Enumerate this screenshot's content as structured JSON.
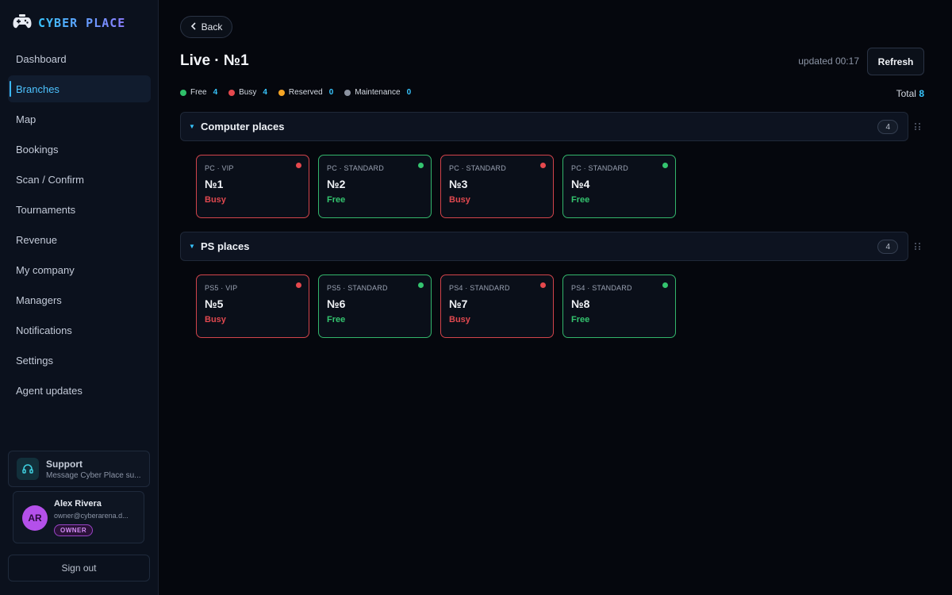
{
  "brand": {
    "name": "CYBER PLACE"
  },
  "sidebar": {
    "items": [
      {
        "label": "Dashboard"
      },
      {
        "label": "Branches"
      },
      {
        "label": "Map"
      },
      {
        "label": "Bookings"
      },
      {
        "label": "Scan / Confirm"
      },
      {
        "label": "Tournaments"
      },
      {
        "label": "Revenue"
      },
      {
        "label": "My company"
      },
      {
        "label": "Managers"
      },
      {
        "label": "Notifications"
      },
      {
        "label": "Settings"
      },
      {
        "label": "Agent updates"
      }
    ],
    "active_index": 1
  },
  "support": {
    "title": "Support",
    "subtitle": "Message Cyber Place su..."
  },
  "user": {
    "initials": "AR",
    "name": "Alex Rivera",
    "email": "owner@cyberarena.d...",
    "role": "OWNER"
  },
  "signout_label": "Sign out",
  "header": {
    "back_label": "Back",
    "title": "Live · №1",
    "updated": "updated 00:17",
    "refresh_label": "Refresh"
  },
  "legend": [
    {
      "label": "Free",
      "count": "4",
      "color": "#2fc06a"
    },
    {
      "label": "Busy",
      "count": "4",
      "color": "#e5484d"
    },
    {
      "label": "Reserved",
      "count": "0",
      "color": "#f5a524"
    },
    {
      "label": "Maintenance",
      "count": "0",
      "color": "#8b92a0"
    }
  ],
  "total": {
    "label": "Total",
    "value": "8"
  },
  "sections": [
    {
      "title": "Computer places",
      "count": "4",
      "places": [
        {
          "type": "PC · VIP",
          "number": "№1",
          "status": "Busy"
        },
        {
          "type": "PC · STANDARD",
          "number": "№2",
          "status": "Free"
        },
        {
          "type": "PC · STANDARD",
          "number": "№3",
          "status": "Busy"
        },
        {
          "type": "PC · STANDARD",
          "number": "№4",
          "status": "Free"
        }
      ]
    },
    {
      "title": "PS places",
      "count": "4",
      "places": [
        {
          "type": "PS5 · VIP",
          "number": "№5",
          "status": "Busy"
        },
        {
          "type": "PS5 · STANDARD",
          "number": "№6",
          "status": "Free"
        },
        {
          "type": "PS4 · STANDARD",
          "number": "№7",
          "status": "Busy"
        },
        {
          "type": "PS4 · STANDARD",
          "number": "№8",
          "status": "Free"
        }
      ]
    }
  ]
}
